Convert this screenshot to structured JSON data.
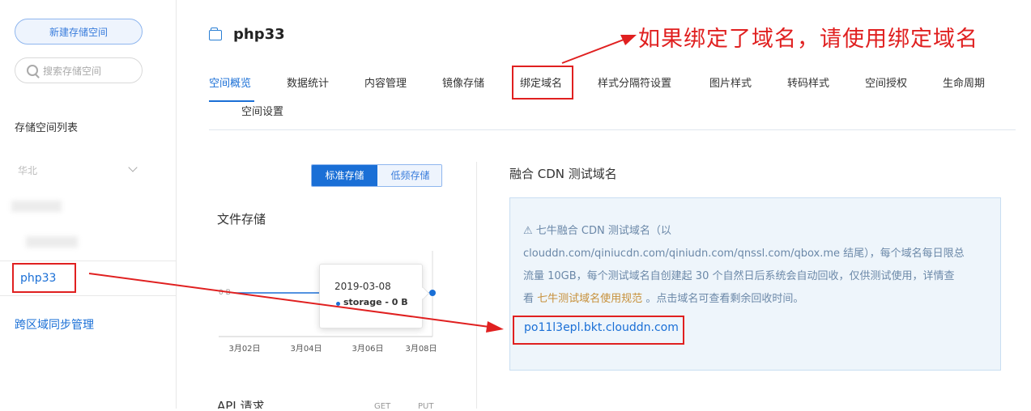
{
  "sidebar": {
    "new_bucket_button": "新建存储空间",
    "search_placeholder": "搜索存储空间",
    "list_title": "存储空间列表",
    "region": "华北",
    "active_bucket": "php33",
    "cross_region_link": "跨区域同步管理"
  },
  "header": {
    "title": "php33"
  },
  "annotation": "如果绑定了域名，请使用绑定域名",
  "tabs": [
    {
      "label": "空间概览",
      "active": true
    },
    {
      "label": "数据统计"
    },
    {
      "label": "内容管理"
    },
    {
      "label": "镜像存储"
    },
    {
      "label": "绑定域名",
      "highlighted": true
    },
    {
      "label": "样式分隔符设置"
    },
    {
      "label": "图片样式"
    },
    {
      "label": "转码样式"
    },
    {
      "label": "空间授权"
    },
    {
      "label": "生命周期"
    },
    {
      "label": "空间设置"
    }
  ],
  "storage_toggle": {
    "standard": "标准存储",
    "low_freq": "低频存储",
    "selected": "标准存储"
  },
  "file_storage_title": "文件存储",
  "chart_data": {
    "type": "line",
    "x": [
      "3月02日",
      "3月04日",
      "3月06日",
      "3月08日"
    ],
    "series": [
      {
        "name": "storage",
        "values": [
          0,
          0,
          0,
          0
        ]
      }
    ],
    "ylabel_tick": "0 B",
    "tooltip": {
      "date": "2019-03-08",
      "series": "storage",
      "value": "0 B"
    }
  },
  "tooltip": {
    "date": "2019-03-08",
    "text": "storage - 0 B"
  },
  "api_section": {
    "title": "API 请求",
    "get": "GET",
    "put": "PUT"
  },
  "cdn": {
    "title": "融合 CDN 测试域名",
    "warning_line1": "七牛融合 CDN 测试域名（以",
    "warning_line2": "clouddn.com/qiniucdn.com/qiniudn.com/qnssl.com/qbox.me 结尾），每个域名每日限总",
    "warning_line3": "流量 10GB，每个测试域名自创建起 30 个自然日后系统会自动回收，仅供测试使用，详情查",
    "warning_line4_a": "看",
    "warning_link": "七牛测试域名使用规范",
    "warning_line4_b": "。点击域名可查看剩余回收时间。",
    "domain": "po11l3epl.bkt.clouddn.com"
  },
  "colors": {
    "accent": "#1a6fd6",
    "annotation_red": "#e02020",
    "info_bg": "#eef5fb"
  }
}
